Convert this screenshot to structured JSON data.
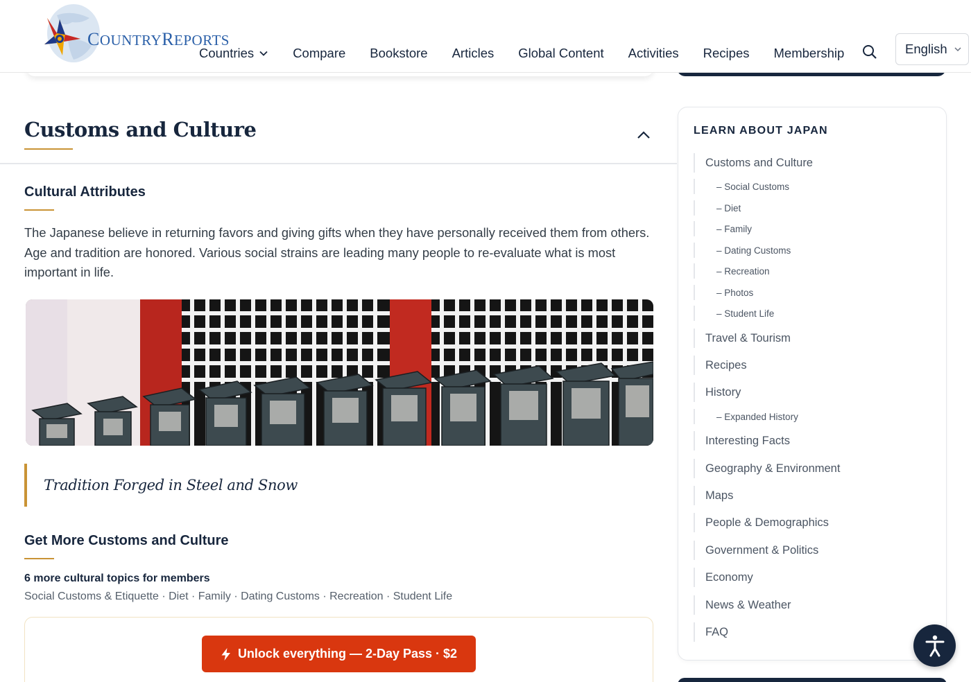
{
  "brand": {
    "logo_text_lead_1": "C",
    "logo_text_rest_1": "OUNTRY",
    "logo_text_lead_2": "R",
    "logo_text_rest_2": "EPORTS"
  },
  "nav": {
    "items": [
      "Countries",
      "Compare",
      "Bookstore",
      "Articles",
      "Global Content",
      "Activities",
      "Recipes",
      "Membership"
    ],
    "language": "English"
  },
  "section": {
    "title": "Customs and Culture",
    "subsection_title": "Cultural Attributes",
    "paragraph": "The Japanese believe in returning favors and giving gifts when they have personally received them from others. Age and tradition are honored. Various social strains are leading many people to re-evaluate what is most important in life.",
    "quote": "Tradition Forged in Steel and Snow",
    "more_title": "Get More Customs and Culture",
    "members_heading": "6 more cultural topics for members",
    "members_list": "Social Customs & Etiquette · Diet · Family · Dating Customs · Recreation · Student Life",
    "unlock_label": "Unlock everything — 2-Day Pass · $2"
  },
  "sidebar": {
    "heading": "LEARN ABOUT JAPAN",
    "items": [
      {
        "label": "Customs and Culture",
        "level": "main"
      },
      {
        "label": "– Social Customs",
        "level": "sub"
      },
      {
        "label": "– Diet",
        "level": "sub"
      },
      {
        "label": "– Family",
        "level": "sub"
      },
      {
        "label": "– Dating Customs",
        "level": "sub"
      },
      {
        "label": "– Recreation",
        "level": "sub"
      },
      {
        "label": "– Photos",
        "level": "sub"
      },
      {
        "label": "– Student Life",
        "level": "sub"
      },
      {
        "label": "Travel & Tourism",
        "level": "main"
      },
      {
        "label": "Recipes",
        "level": "main"
      },
      {
        "label": "History",
        "level": "main"
      },
      {
        "label": "– Expanded History",
        "level": "sub"
      },
      {
        "label": "Interesting Facts",
        "level": "main"
      },
      {
        "label": "Geography & Environment",
        "level": "main"
      },
      {
        "label": "Maps",
        "level": "main"
      },
      {
        "label": "People & Demographics",
        "level": "main"
      },
      {
        "label": "Government & Politics",
        "level": "main"
      },
      {
        "label": "Economy",
        "level": "main"
      },
      {
        "label": "News & Weather",
        "level": "main"
      },
      {
        "label": "FAQ",
        "level": "main"
      }
    ]
  },
  "colors": {
    "navy": "#17263d",
    "gold_accent": "#c99335",
    "cta_orange": "#d9370f"
  },
  "icons": [
    "logo-compass-star-icon",
    "chevron-down-icon",
    "search-icon",
    "chevron-up-icon",
    "bolt-icon",
    "accessibility-icon"
  ]
}
